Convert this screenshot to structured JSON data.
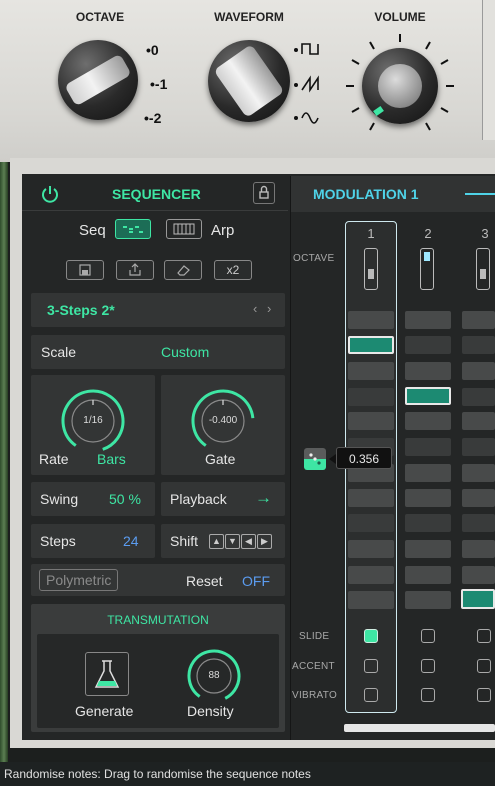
{
  "synth": {
    "octave_label": "OCTAVE",
    "octave_marks": [
      "0",
      "-1",
      "-2"
    ],
    "waveform_label": "WAVEFORM",
    "volume_label": "VOLUME"
  },
  "sequencer": {
    "title": "SEQUENCER",
    "seq_label": "Seq",
    "arp_label": "Arp",
    "x2_label": "x2",
    "preset_name": "3-Steps 2*",
    "scale_label": "Scale",
    "scale_value": "Custom",
    "rate_knob_value": "1/16",
    "rate_label": "Rate",
    "rate_unit": "Bars",
    "gate_knob_value": "-0.400",
    "gate_label": "Gate",
    "swing_label": "Swing",
    "swing_value": "50 %",
    "playback_label": "Playback",
    "playback_arrow": "→",
    "steps_label": "Steps",
    "steps_value": "24",
    "shift_label": "Shift",
    "polymetric_label": "Polymetric",
    "reset_label": "Reset",
    "reset_value": "OFF",
    "transmutation_title": "TRANSMUTATION",
    "generate_label": "Generate",
    "density_value": "88",
    "density_label": "Density"
  },
  "modulation": {
    "tab_title": "MODULATION 1",
    "column_numbers": [
      "1",
      "2",
      "3"
    ],
    "octave_row": "OCTAVE",
    "slide_row": "SLIDE",
    "accent_row": "ACCENT",
    "vibrato_row": "VIBRATO",
    "tooltip_value": "0.356"
  },
  "status_bar": {
    "text": "Randomise notes: Drag to randomise the sequence notes"
  },
  "colors": {
    "accent": "#3ee6a4",
    "blue_value": "#5b9cf0",
    "active_cell": "#1c8a72"
  }
}
